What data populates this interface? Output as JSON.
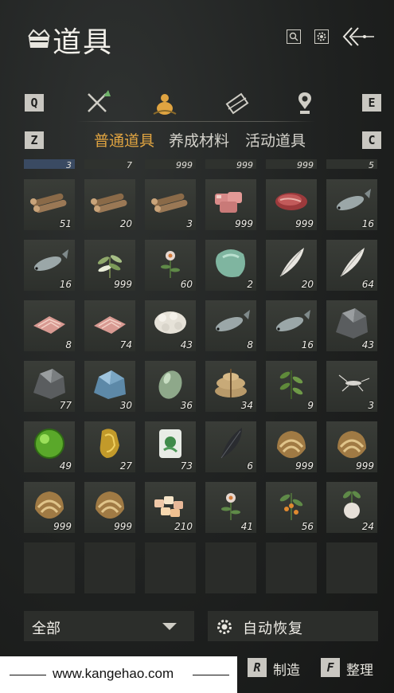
{
  "header": {
    "title": "道具",
    "title_icon": "bundle-icon",
    "search_icon": "search-icon",
    "settings_icon": "gear-icon",
    "back_icon": "back-arrow-icon"
  },
  "tabs": {
    "left_key": "Q",
    "right_key": "E",
    "icons": [
      "swords-icon",
      "gourd-icon",
      "scroll-icon",
      "map-marker-icon"
    ],
    "active_index": 1
  },
  "subtabs": {
    "left_key": "Z",
    "right_key": "C",
    "items": [
      "普通道具",
      "养成材料",
      "活动道具"
    ],
    "active_index": 0
  },
  "partial_row": [
    "3",
    "7",
    "999",
    "999",
    "999",
    "5"
  ],
  "items": [
    {
      "icon": "logs-icon",
      "count": "51"
    },
    {
      "icon": "logs-icon",
      "count": "20"
    },
    {
      "icon": "logs-icon",
      "count": "3"
    },
    {
      "icon": "raw-meat-icon",
      "count": "999"
    },
    {
      "icon": "steak-icon",
      "count": "999"
    },
    {
      "icon": "fish-icon",
      "count": "16"
    },
    {
      "icon": "fish-icon",
      "count": "16"
    },
    {
      "icon": "herb-icon",
      "count": "999"
    },
    {
      "icon": "flower-icon",
      "count": "60"
    },
    {
      "icon": "jade-stone-icon",
      "count": "2"
    },
    {
      "icon": "feather-icon",
      "count": "20"
    },
    {
      "icon": "feather-icon",
      "count": "64"
    },
    {
      "icon": "fish-fillet-icon",
      "count": "8"
    },
    {
      "icon": "fish-fillet-icon",
      "count": "74"
    },
    {
      "icon": "fleece-icon",
      "count": "43"
    },
    {
      "icon": "fish-icon",
      "count": "8"
    },
    {
      "icon": "fish-icon",
      "count": "16"
    },
    {
      "icon": "ore-icon",
      "count": "43"
    },
    {
      "icon": "ore-icon",
      "count": "77"
    },
    {
      "icon": "crystal-ore-icon",
      "count": "30"
    },
    {
      "icon": "jade-egg-icon",
      "count": "36"
    },
    {
      "icon": "sack-icon",
      "count": "34"
    },
    {
      "icon": "plant-icon",
      "count": "9"
    },
    {
      "icon": "insect-icon",
      "count": "3"
    },
    {
      "icon": "green-orb-icon",
      "count": "49"
    },
    {
      "icon": "gold-ornament-icon",
      "count": "27"
    },
    {
      "icon": "jade-pendant-icon",
      "count": "73"
    },
    {
      "icon": "black-feather-icon",
      "count": "6"
    },
    {
      "icon": "shell-icon",
      "count": "999"
    },
    {
      "icon": "shell-icon",
      "count": "999"
    },
    {
      "icon": "shell-icon",
      "count": "999"
    },
    {
      "icon": "shell-icon",
      "count": "999"
    },
    {
      "icon": "candy-icon",
      "count": "210"
    },
    {
      "icon": "flower-icon",
      "count": "41"
    },
    {
      "icon": "fruit-plant-icon",
      "count": "56"
    },
    {
      "icon": "radish-icon",
      "count": "24"
    }
  ],
  "empty_slots": 6,
  "filter": {
    "label": "全部",
    "arrow_icon": "chevron-down-icon"
  },
  "auto_restore": {
    "label": "自动恢复",
    "icon": "gear-icon"
  },
  "watermark": {
    "text": "www.kangehao.com"
  },
  "actions": [
    {
      "key": "R",
      "label": "制造"
    },
    {
      "key": "F",
      "label": "整理"
    }
  ],
  "colors": {
    "active": "#e0a441",
    "cell": "#353833",
    "background": "#1f2120"
  }
}
